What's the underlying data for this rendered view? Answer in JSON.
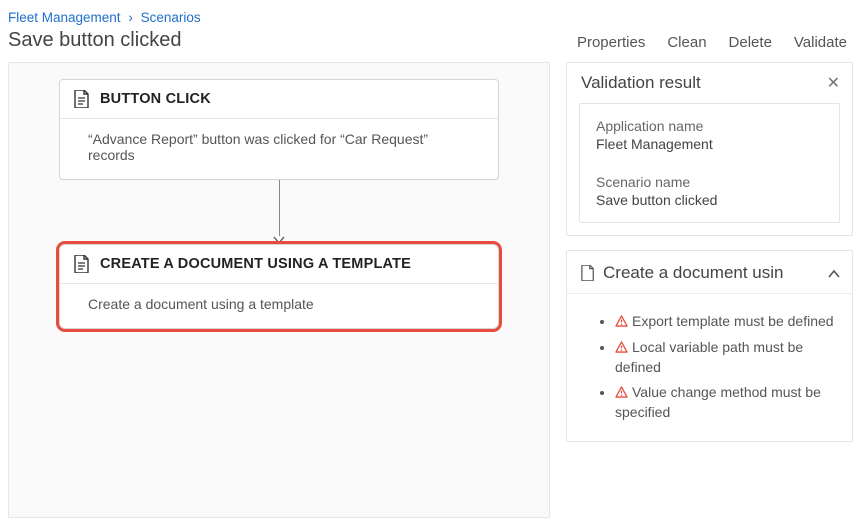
{
  "breadcrumb": {
    "segment1": "Fleet Management",
    "segment2": "Scenarios"
  },
  "page_title": "Save button clicked",
  "actions": {
    "properties": "Properties",
    "clean": "Clean",
    "delete": "Delete",
    "validate": "Validate"
  },
  "nodes": {
    "button_click": {
      "title": "BUTTON CLICK",
      "body": "“Advance Report” button was clicked for “Car Request” records"
    },
    "create_doc": {
      "title": "CREATE A DOCUMENT USING A TEMPLATE",
      "body": "Create a document using a template"
    }
  },
  "validation": {
    "header": "Validation result",
    "app_name_label": "Application name",
    "app_name_value": "Fleet Management",
    "scenario_name_label": "Scenario name",
    "scenario_name_value": "Save button clicked",
    "section_title": "Create a document usin",
    "issues": [
      "Export template must be defined",
      "Local variable path must be defined",
      "Value change method must be specified"
    ]
  }
}
